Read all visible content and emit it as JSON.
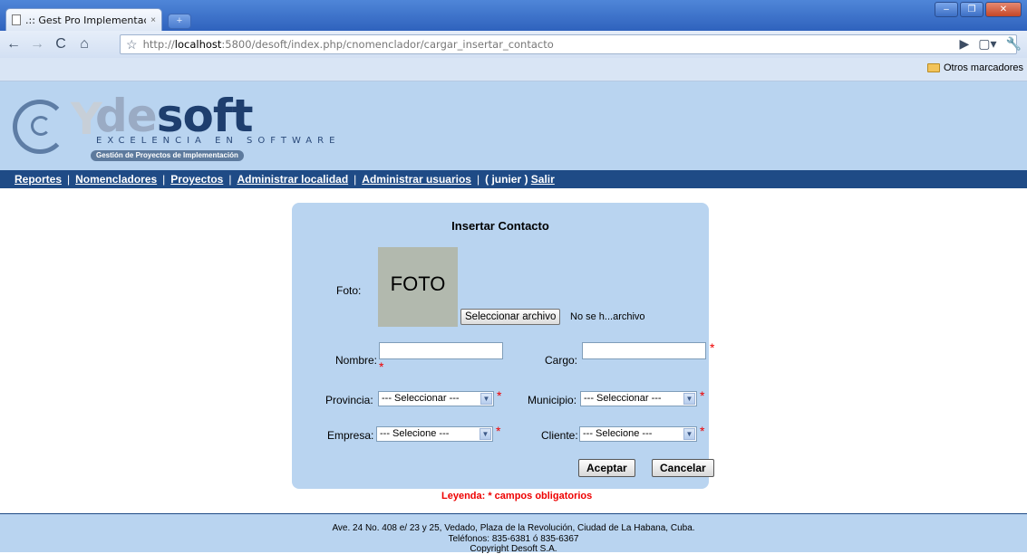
{
  "browser": {
    "tab_title": ".:: Gest Pro Implementació...",
    "tab_close": "×",
    "new_tab": "+",
    "url_prefix": "http://",
    "url_host": "localhost",
    "url_rest": ":5800/desoft/index.php/cnomenclador/cargar_insertar_contacto",
    "bookmark_folder": "Otros marcadores",
    "icons": [
      "back-icon",
      "forward-icon",
      "reload-icon",
      "home-icon",
      "star-icon",
      "play-icon",
      "page-icon",
      "wrench-icon",
      "folder-icon"
    ]
  },
  "header": {
    "brand_de": "de",
    "brand_soft": "soft",
    "tagline": "EXCELENCIA EN SOFTWARE",
    "subtitle": "Gestión de Proyectos de Implementación"
  },
  "menu": {
    "reportes": "Reportes",
    "nomencladores": "Nomencladores",
    "proyectos": "Proyectos",
    "localidad": "Administrar localidad",
    "usuarios": "Administrar usuarios",
    "user": "( junier )",
    "salir": "Salir",
    "sep": "|"
  },
  "form": {
    "title": "Insertar Contacto",
    "foto_label": "Foto:",
    "photo_text": "FOTO",
    "file_button": "Seleccionar archivo",
    "file_status": "No se h...archivo",
    "nombre_label": "Nombre:",
    "cargo_label": "Cargo:",
    "provincia_label": "Provincia:",
    "provincia_value": "--- Seleccionar ---",
    "municipio_label": "Municipio:",
    "municipio_value": "--- Seleccionar ---",
    "empresa_label": "Empresa:",
    "empresa_value": "--- Selecione ---",
    "cliente_label": "Cliente:",
    "cliente_value": "--- Selecione ---",
    "required_mark": "*",
    "accept": "Aceptar",
    "cancel": "Cancelar",
    "legend": "Leyenda: * campos obligatorios"
  },
  "footer": {
    "address": "Ave. 24 No. 408 e/ 23 y 25, Vedado, Plaza de la Revolución, Ciudad de La Habana, Cuba.",
    "phones": "Teléfonos: 835-6381 ó 835-6367",
    "copyright": "Copyright Desoft S.A."
  },
  "colors": {
    "header_bg": "#b9d4f0",
    "menu_bg": "#1f4b86",
    "required": "#ee0000"
  }
}
